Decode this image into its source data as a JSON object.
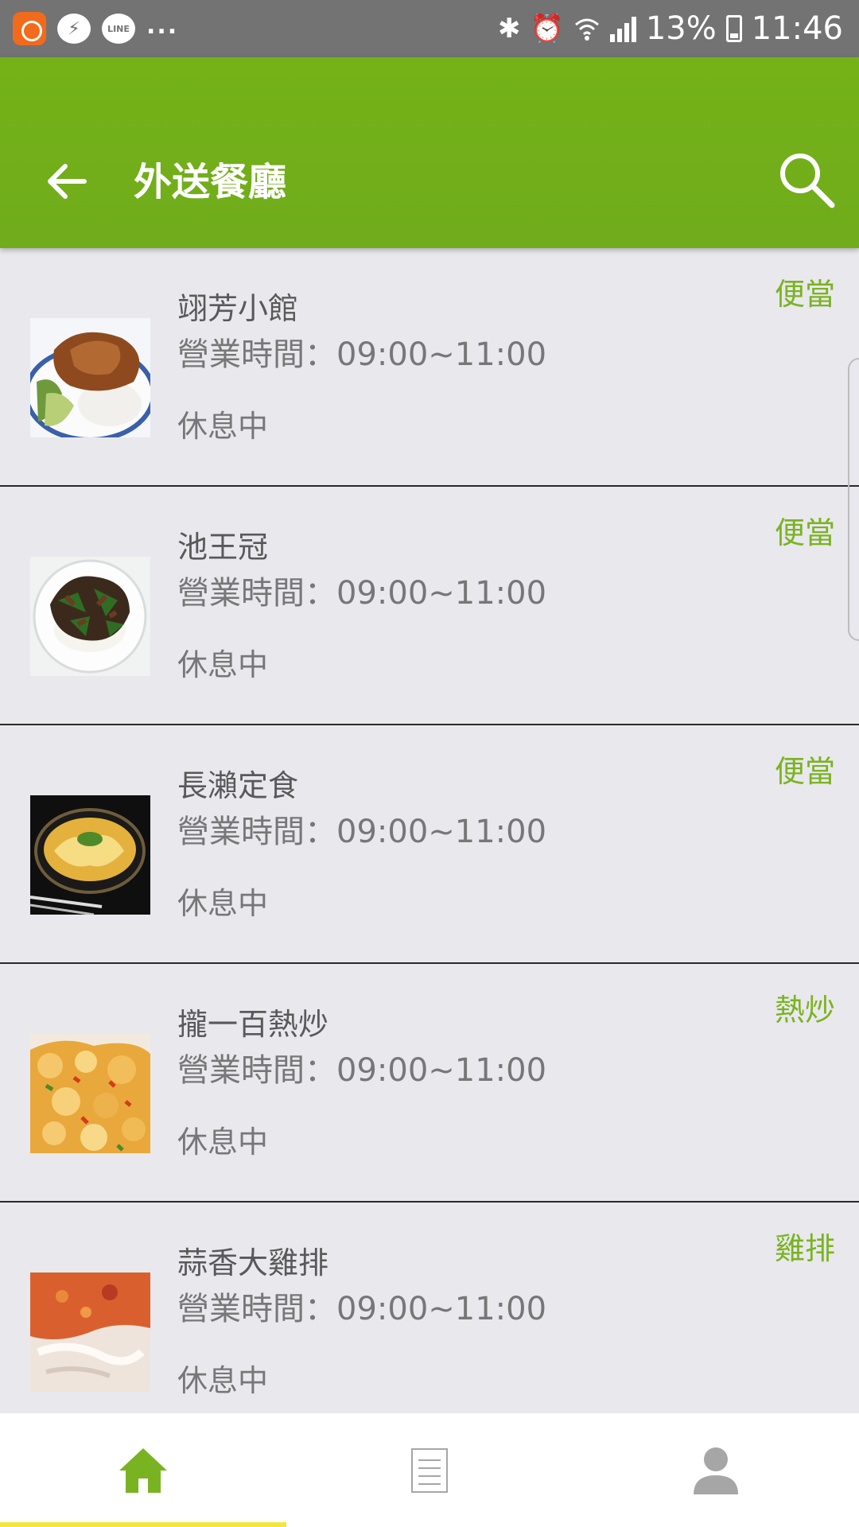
{
  "status_bar": {
    "notification_icons": [
      "app-notification-icon",
      "messenger-icon",
      "line-icon"
    ],
    "line_icon_text": "LINE",
    "more": "...",
    "battery": "13%",
    "time": "11:46"
  },
  "app_bar": {
    "title": "外送餐廳",
    "back_icon": "arrow-left-icon",
    "search_icon": "search-icon",
    "background": "#74b217"
  },
  "restaurants": [
    {
      "name": "翊芳小館",
      "hours": "營業時間：09:00~11:00",
      "status": "休息中",
      "category": "便當",
      "thumb": "roast-chicken-rice"
    },
    {
      "name": "池王冠",
      "hours": "營業時間：09:00~11:00",
      "status": "休息中",
      "category": "便當",
      "thumb": "stir-fried-beef-rice"
    },
    {
      "name": "長瀨定食",
      "hours": "營業時間：09:00~11:00",
      "status": "休息中",
      "category": "便當",
      "thumb": "oyakodon-bowl"
    },
    {
      "name": "攏一百熱炒",
      "hours": "營業時間：09:00~11:00",
      "status": "休息中",
      "category": "熱炒",
      "thumb": "fried-squid"
    },
    {
      "name": "蒜香大雞排",
      "hours": "營業時間：09:00~11:00",
      "status": "休息中",
      "category": "雞排",
      "thumb": "fried-chicken-cutlet"
    }
  ],
  "bottom_nav": {
    "items": [
      "home-icon",
      "document-icon",
      "person-icon"
    ],
    "active_color": "#7ab321",
    "inactive_color": "#a6a6a6",
    "indicator_color": "#f5e73a"
  }
}
